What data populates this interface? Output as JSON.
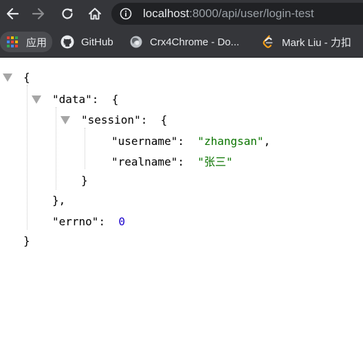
{
  "browser": {
    "url_host": "localhost",
    "url_path": ":8000/api/user/login-test",
    "bookmarks": [
      {
        "label": "应用",
        "icon": "apps-grid-icon"
      },
      {
        "label": "GitHub",
        "icon": "github-icon"
      },
      {
        "label": "Crx4Chrome - Do...",
        "icon": "crx4chrome-icon"
      },
      {
        "label": "Mark Liu - 力扣",
        "icon": "leetcode-icon"
      }
    ]
  },
  "json_view": {
    "open_root": "{",
    "data_key": "\"data\"",
    "colon": ":",
    "open_brace": "{",
    "session_key": "\"session\"",
    "username_key": "\"username\"",
    "username_value": "\"zhangsan\"",
    "comma": ",",
    "realname_key": "\"realname\"",
    "realname_value": "\"张三\"",
    "close_session": "}",
    "close_data": "},",
    "errno_key": "\"errno\"",
    "errno_value": "0",
    "close_root": "}"
  },
  "colors": {
    "toolbar": "#35363a",
    "omnibox": "#202124",
    "string_value": "#0b7500",
    "number_value": "#1a01cc"
  }
}
